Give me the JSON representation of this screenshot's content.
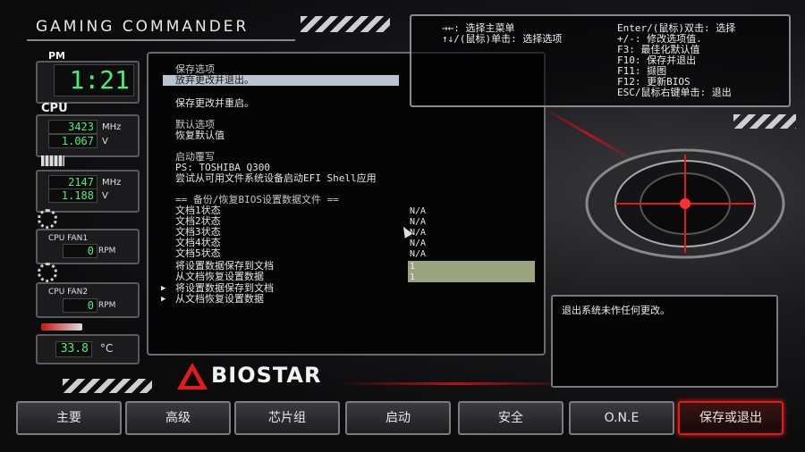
{
  "header": {
    "brand": "GAMING COMMANDER"
  },
  "clock": {
    "label": "PM",
    "time": "1:21"
  },
  "cpu": {
    "label": "CPU",
    "freq": "3423",
    "freq_unit": "MHz",
    "volt": "1.067",
    "volt_unit": "V"
  },
  "mem": {
    "freq": "2147",
    "freq_unit": "MHz",
    "volt": "1.188",
    "volt_unit": "V"
  },
  "fan1": {
    "label": "CPU FAN1",
    "rpm": "0",
    "unit": "RPM"
  },
  "fan2": {
    "label": "CPU FAN2",
    "rpm": "0",
    "unit": "RPM"
  },
  "temp": {
    "value": "33.8",
    "unit": "°C"
  },
  "menu": {
    "save_header": "保存选项",
    "discard_exit": "放弃更改并退出。",
    "save_reset": "保存更改并重启。",
    "default_header": "默认选项",
    "restore_defaults": "恢复默认值",
    "boot_override_header": "启动覆写",
    "boot_device": "PS: TOSHIBA Q300",
    "efi_shell": "尝试从可用文件系统设备启动EFI Shell应用",
    "backup_header": "== 备份/恢复BIOS设置数据文件 ==",
    "files": [
      {
        "label": "文档1状态",
        "value": "N/A"
      },
      {
        "label": "文档2状态",
        "value": "N/A"
      },
      {
        "label": "文档3状态",
        "value": "N/A"
      },
      {
        "label": "文档4状态",
        "value": "N/A"
      },
      {
        "label": "文档5状态",
        "value": "N/A"
      }
    ],
    "save_to_file": "将设置数据保存到文档",
    "save_to_file_value": "1",
    "load_from_file": "从文档恢复设置数据",
    "load_from_file_value": "1",
    "save_to_file_sub": "将设置数据保存到文档",
    "load_from_file_sub": "从文档恢复设置数据"
  },
  "help": {
    "left": [
      "→←: 选择主菜单",
      "↑↓/(鼠标)单击: 选择选项"
    ],
    "right": [
      "Enter/(鼠标)双击: 选择",
      "+/-: 修改选项值.",
      "F3: 最佳化默认值",
      "F10: 保存并退出",
      "F11: 撷图",
      "F12: 更新BIOS",
      "ESC/鼠标右键单击: 退出"
    ]
  },
  "description": "退出系统未作任何更改。",
  "logo_text": "BIOSTAR",
  "tabs": [
    "主要",
    "高级",
    "芯片组",
    "启动",
    "安全",
    "O.N.E",
    "保存或退出"
  ],
  "active_tab": "保存或退出",
  "accent": "#e21a1a",
  "lcd_color": "#44f27a"
}
